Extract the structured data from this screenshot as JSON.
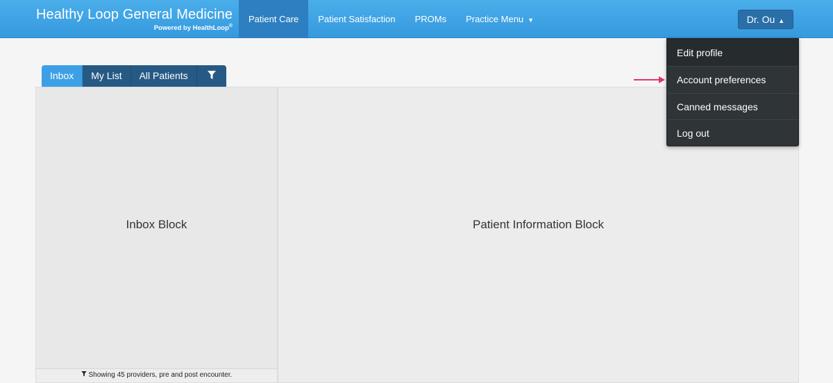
{
  "brand": {
    "title": "Healthy Loop General Medicine",
    "subtitle": "Powered by HealthLoop",
    "reg_mark": "®"
  },
  "nav": {
    "items": [
      {
        "label": "Patient Care",
        "active": true
      },
      {
        "label": "Patient Satisfaction"
      },
      {
        "label": "PROMs"
      },
      {
        "label": "Practice Menu"
      }
    ]
  },
  "user_menu": {
    "label": "Dr. Ou",
    "items": [
      {
        "label": "Edit profile"
      },
      {
        "label": "Account preferences"
      },
      {
        "label": "Canned messages"
      },
      {
        "label": "Log out"
      }
    ]
  },
  "tabs": [
    {
      "label": "Inbox",
      "active": true
    },
    {
      "label": "My List"
    },
    {
      "label": "All Patients"
    }
  ],
  "inbox": {
    "label": "Inbox Block",
    "footer": "Showing 45 providers, pre and post encounter."
  },
  "patient": {
    "label": "Patient Information Block"
  },
  "icons": [
    "caret-down-icon",
    "caret-up-icon",
    "filter-icon",
    "pointer-arrow-icon"
  ],
  "colors": {
    "header": "#3da2e6",
    "nav_active": "#2d7fc1",
    "tab_dark": "#265a85",
    "dropdown": "#2f3436",
    "annotation_arrow": "#e4336c"
  }
}
